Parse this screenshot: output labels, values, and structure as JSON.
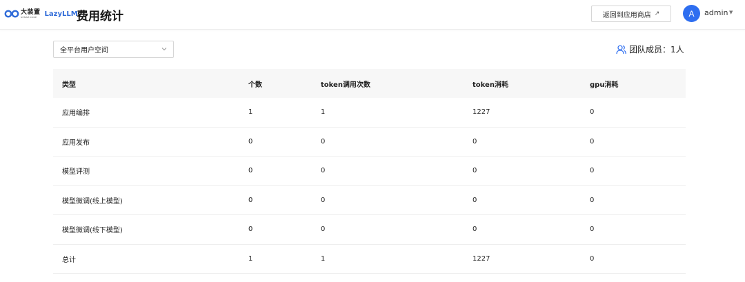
{
  "header": {
    "logo_cn": "大装置",
    "logo_en": "SENSECORE",
    "logo_product": "LazyLLM",
    "title": "费用统计",
    "back_button": "返回到应用商店",
    "avatar_letter": "A",
    "username": "admin"
  },
  "filter": {
    "selected": "全平台用户空间"
  },
  "team": {
    "label": "团队成员：1人"
  },
  "table": {
    "columns": [
      "类型",
      "个数",
      "token调用次数",
      "token消耗",
      "gpu消耗"
    ],
    "rows": [
      [
        "应用编排",
        "1",
        "1",
        "1227",
        "0"
      ],
      [
        "应用发布",
        "0",
        "0",
        "0",
        "0"
      ],
      [
        "模型评测",
        "0",
        "0",
        "0",
        "0"
      ],
      [
        "模型微调(线上模型)",
        "0",
        "0",
        "0",
        "0"
      ],
      [
        "模型微调(线下模型)",
        "0",
        "0",
        "0",
        "0"
      ],
      [
        "总计",
        "1",
        "1",
        "1227",
        "0"
      ]
    ]
  },
  "colors": {
    "accent": "#2e6ef0",
    "brand": "#2f6bd8",
    "header_bg": "#f7f7f7"
  }
}
